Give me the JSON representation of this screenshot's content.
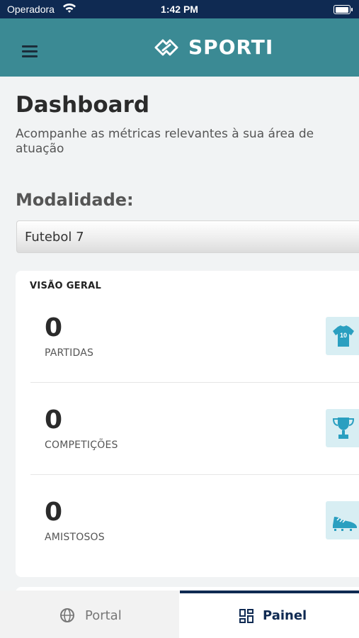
{
  "status_bar": {
    "carrier": "Operadora",
    "time": "1:42 PM"
  },
  "header": {
    "app_name": "SPORTI"
  },
  "page": {
    "title": "Dashboard",
    "subtitle": "Acompanhe as métricas relevantes à sua área de atuação",
    "modality_label": "Modalidade:",
    "modality_value": "Futebol 7"
  },
  "overview": {
    "title": "VISÃO GERAL",
    "stats": [
      {
        "value": "0",
        "label": "PARTIDAS",
        "icon": "jersey-icon"
      },
      {
        "value": "0",
        "label": "COMPETIÇÕES",
        "icon": "trophy-icon"
      },
      {
        "value": "0",
        "label": "AMISTOSOS",
        "icon": "cleat-icon"
      }
    ]
  },
  "tabs": [
    {
      "label": "Portal",
      "icon": "globe-icon"
    },
    {
      "label": "Painel",
      "icon": "dashboard-icon"
    }
  ],
  "colors": {
    "status_bar": "#0f2a52",
    "header": "#3b8a94",
    "accent": "#2a9fc0",
    "icon_bg": "#d8eef3",
    "active_tab": "#0f2a52"
  }
}
